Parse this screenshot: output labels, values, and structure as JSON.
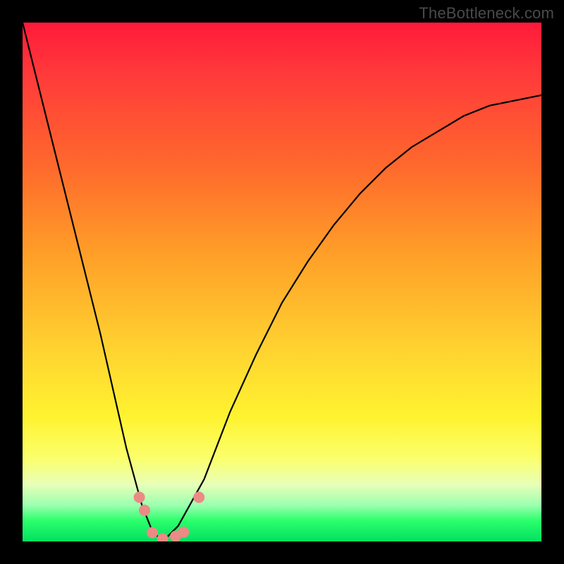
{
  "watermark": "TheBottleneck.com",
  "chart_data": {
    "type": "line",
    "title": "",
    "xlabel": "",
    "ylabel": "",
    "xlim": [
      0,
      1
    ],
    "ylim": [
      0,
      1
    ],
    "series": [
      {
        "name": "bottleneck-curve",
        "x": [
          0.0,
          0.05,
          0.1,
          0.15,
          0.2,
          0.23,
          0.25,
          0.27,
          0.3,
          0.35,
          0.4,
          0.45,
          0.5,
          0.55,
          0.6,
          0.65,
          0.7,
          0.75,
          0.8,
          0.85,
          0.9,
          0.95,
          1.0
        ],
        "y": [
          1.0,
          0.8,
          0.6,
          0.4,
          0.18,
          0.07,
          0.02,
          0.0,
          0.03,
          0.12,
          0.25,
          0.36,
          0.46,
          0.54,
          0.61,
          0.67,
          0.72,
          0.76,
          0.79,
          0.82,
          0.84,
          0.85,
          0.86
        ]
      }
    ],
    "markers": [
      {
        "name": "point-left-a",
        "x": 0.225,
        "y": 0.085
      },
      {
        "name": "point-left-b",
        "x": 0.235,
        "y": 0.06
      },
      {
        "name": "point-bottom-a",
        "x": 0.25,
        "y": 0.017
      },
      {
        "name": "point-bottom-b",
        "x": 0.27,
        "y": 0.005
      },
      {
        "name": "point-bottom-c",
        "x": 0.295,
        "y": 0.01
      },
      {
        "name": "point-bottom-d",
        "x": 0.31,
        "y": 0.018
      },
      {
        "name": "point-right-a",
        "x": 0.34,
        "y": 0.085
      }
    ],
    "marker_style": {
      "shape": "circle",
      "color": "#ec8a85",
      "radius_px": 8
    }
  }
}
